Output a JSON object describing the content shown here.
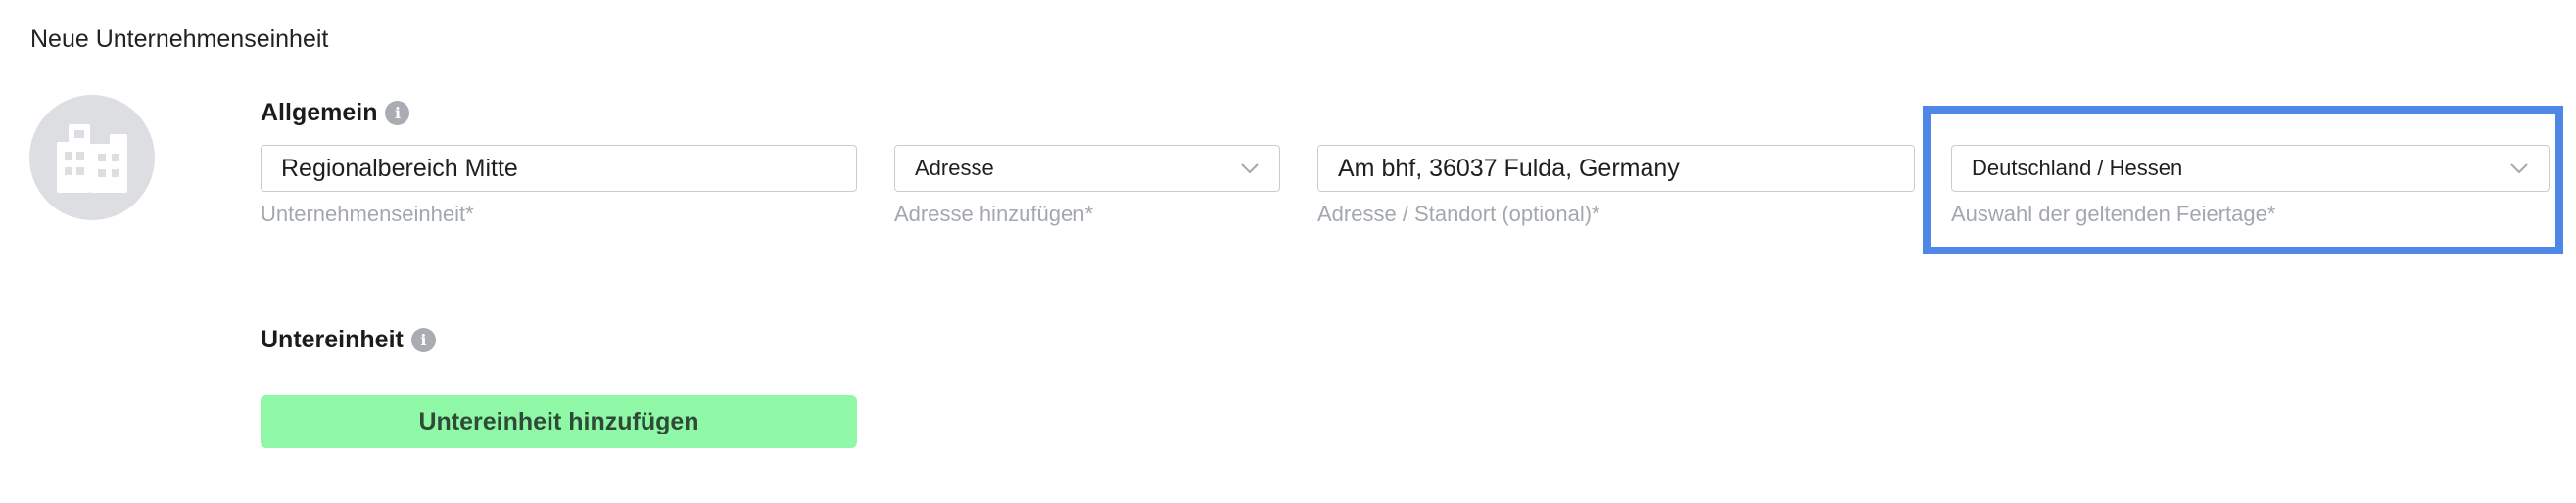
{
  "page": {
    "title": "Neue Unternehmenseinheit"
  },
  "avatar": {
    "icon": "building-icon",
    "color": "#dcdee2"
  },
  "general": {
    "heading": "Allgemein",
    "info_icon": "i",
    "unit_field": {
      "value": "Regionalbereich Mitte",
      "helper": "Unternehmenseinheit*"
    },
    "address_select": {
      "value": "Adresse",
      "helper": "Adresse hinzufügen*"
    },
    "location_field": {
      "value": "Am bhf, 36037 Fulda, Germany",
      "helper": "Adresse / Standort (optional)*"
    },
    "holiday_select": {
      "value": "Deutschland / Hessen",
      "helper": "Auswahl der geltenden Feiertage*"
    }
  },
  "subunit": {
    "heading": "Untereinheit",
    "info_icon": "i",
    "add_button_label": "Untereinheit hinzufügen"
  },
  "colors": {
    "highlight": "#4f87e6",
    "add_button": "#8ff8a6",
    "helper_text": "#a3a8ae"
  }
}
